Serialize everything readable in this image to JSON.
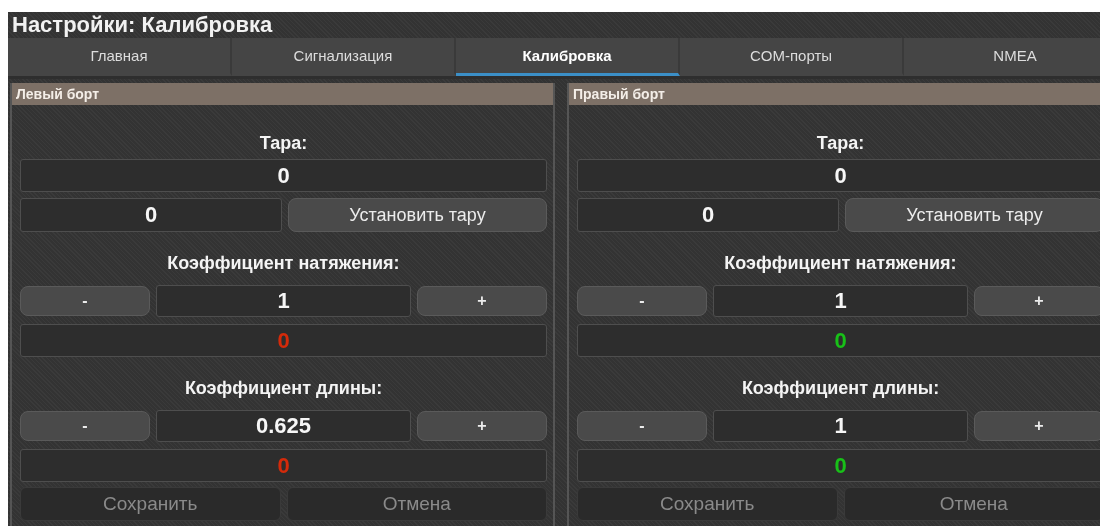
{
  "window": {
    "title": "Настройки: Калибровка"
  },
  "tabs": [
    {
      "label": "Главная",
      "selected": false
    },
    {
      "label": "Сигнализация",
      "selected": false
    },
    {
      "label": "Калибровка",
      "selected": true
    },
    {
      "label": "COM-порты",
      "selected": false
    },
    {
      "label": "NMEA",
      "selected": false
    }
  ],
  "panels": [
    {
      "title": "Левый борт",
      "tare_label": "Тара:",
      "tare_value": "0",
      "tare_input": "0",
      "tare_button": "Установить тару",
      "sections": [
        {
          "label": "Коэффициент натяжения:",
          "minus": "-",
          "value": "1",
          "plus": "+",
          "reading": "0",
          "color": "#d42a0a"
        },
        {
          "label": "Коэффициент длины:",
          "minus": "-",
          "value": "0.625",
          "plus": "+",
          "reading": "0",
          "color": "#d42a0a"
        }
      ],
      "buttons": [
        {
          "label": "Сохранить",
          "disabled": true
        },
        {
          "label": "Отмена",
          "disabled": true
        }
      ]
    },
    {
      "title": "Правый борт",
      "tare_label": "Тара:",
      "tare_value": "0",
      "tare_input": "0",
      "tare_button": "Установить тару",
      "sections": [
        {
          "label": "Коэффициент натяжения:",
          "minus": "-",
          "value": "1",
          "plus": "+",
          "reading": "0",
          "color": "#18c018"
        },
        {
          "label": "Коэффициент длины:",
          "minus": "-",
          "value": "1",
          "plus": "+",
          "reading": "0",
          "color": "#18c018"
        }
      ],
      "buttons": [
        {
          "label": "Сохранить",
          "disabled": true
        },
        {
          "label": "Отмена",
          "disabled": true
        }
      ]
    }
  ]
}
